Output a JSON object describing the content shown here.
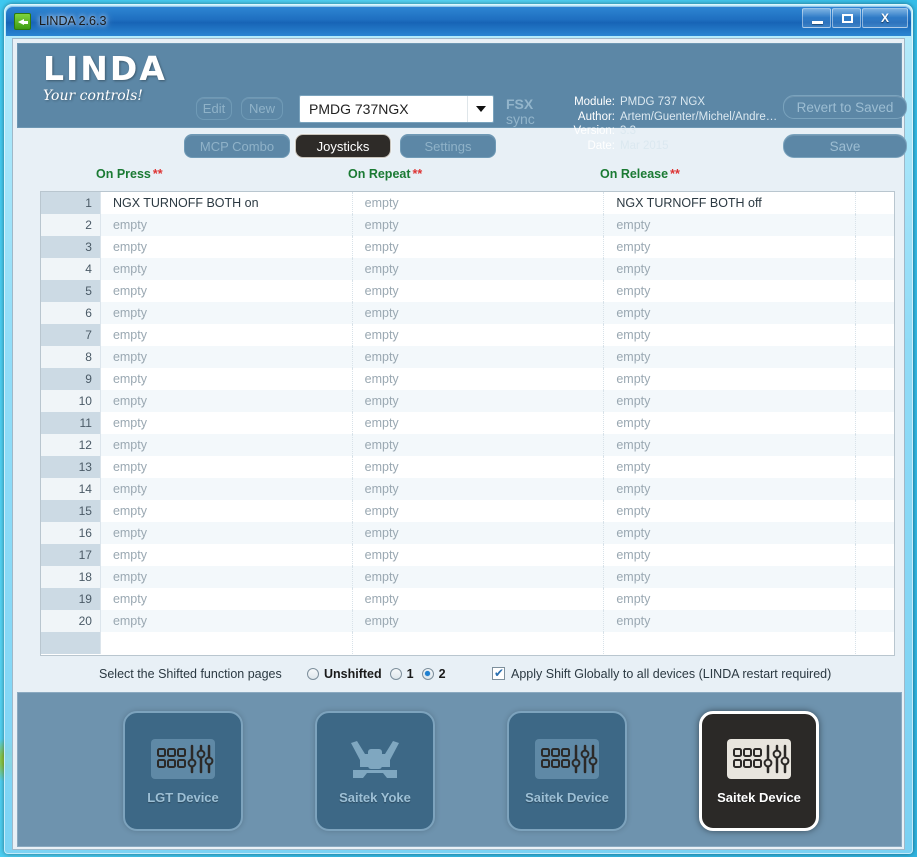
{
  "window": {
    "title": "LINDA 2.6.3",
    "app_icon": "airplane-icon",
    "minimize_label": "–",
    "maximize_label": "□",
    "close_label": "X"
  },
  "header": {
    "logo_brand": "LINDA",
    "logo_tagline": "Your controls!",
    "edit_label": "Edit",
    "new_label": "New",
    "mcp_combo_label": "MCP Combo",
    "joysticks_label": "Joysticks",
    "settings_label": "Settings",
    "aircraft_value": "PMDG 737NGX",
    "fsx_line1": "FSX",
    "fsx_line2": "sync",
    "revert_label": "Revert to Saved",
    "save_label": "Save",
    "meta": [
      {
        "key": "Module:",
        "value": "PMDG 737 NGX"
      },
      {
        "key": "Author:",
        "value": "Artem/Guenter/Michel/Andre…"
      },
      {
        "key": "Version:",
        "value": "3.3"
      },
      {
        "key": "Date:",
        "value": "Mar 2015"
      }
    ]
  },
  "table": {
    "columns": [
      {
        "label": "On Press",
        "stars": "**"
      },
      {
        "label": "On Repeat",
        "stars": "**"
      },
      {
        "label": "On Release",
        "stars": "**"
      }
    ],
    "empty_text": "empty",
    "rows": [
      {
        "n": "1",
        "press": "NGX TURNOFF BOTH on",
        "repeat": "empty",
        "release": "NGX TURNOFF BOTH off"
      },
      {
        "n": "2",
        "press": "empty",
        "repeat": "empty",
        "release": "empty"
      },
      {
        "n": "3",
        "press": "empty",
        "repeat": "empty",
        "release": "empty"
      },
      {
        "n": "4",
        "press": "empty",
        "repeat": "empty",
        "release": "empty"
      },
      {
        "n": "5",
        "press": "empty",
        "repeat": "empty",
        "release": "empty"
      },
      {
        "n": "6",
        "press": "empty",
        "repeat": "empty",
        "release": "empty"
      },
      {
        "n": "7",
        "press": "empty",
        "repeat": "empty",
        "release": "empty"
      },
      {
        "n": "8",
        "press": "empty",
        "repeat": "empty",
        "release": "empty"
      },
      {
        "n": "9",
        "press": "empty",
        "repeat": "empty",
        "release": "empty"
      },
      {
        "n": "10",
        "press": "empty",
        "repeat": "empty",
        "release": "empty"
      },
      {
        "n": "11",
        "press": "empty",
        "repeat": "empty",
        "release": "empty"
      },
      {
        "n": "12",
        "press": "empty",
        "repeat": "empty",
        "release": "empty"
      },
      {
        "n": "13",
        "press": "empty",
        "repeat": "empty",
        "release": "empty"
      },
      {
        "n": "14",
        "press": "empty",
        "repeat": "empty",
        "release": "empty"
      },
      {
        "n": "15",
        "press": "empty",
        "repeat": "empty",
        "release": "empty"
      },
      {
        "n": "16",
        "press": "empty",
        "repeat": "empty",
        "release": "empty"
      },
      {
        "n": "17",
        "press": "empty",
        "repeat": "empty",
        "release": "empty"
      },
      {
        "n": "18",
        "press": "empty",
        "repeat": "empty",
        "release": "empty"
      },
      {
        "n": "19",
        "press": "empty",
        "repeat": "empty",
        "release": "empty"
      },
      {
        "n": "20",
        "press": "empty",
        "repeat": "empty",
        "release": "empty"
      },
      {
        "n": "",
        "press": "",
        "repeat": "",
        "release": ""
      }
    ]
  },
  "shift_bar": {
    "label": "Select the Shifted function pages",
    "options": [
      {
        "label": "Unshifted",
        "selected": false
      },
      {
        "label": "1",
        "selected": false
      },
      {
        "label": "2",
        "selected": true
      }
    ],
    "checkbox_label": "Apply Shift Globally to all devices (LINDA restart required)",
    "checkbox_checked": true
  },
  "devices": [
    {
      "label": "LGT Device",
      "icon": "control-panel-icon",
      "selected": false
    },
    {
      "label": "Saitek Yoke",
      "icon": "yoke-icon",
      "selected": false
    },
    {
      "label": "Saitek Device",
      "icon": "control-panel-icon",
      "selected": false
    },
    {
      "label": "Saitek Device",
      "icon": "control-panel-icon",
      "selected": true
    }
  ],
  "colors": {
    "header_bg": "#5c87a6",
    "accent_green": "#1a7a33",
    "accent_red": "#d33333",
    "selected_device_bg": "#2b2927",
    "radio_dot": "#1d7fd0"
  }
}
